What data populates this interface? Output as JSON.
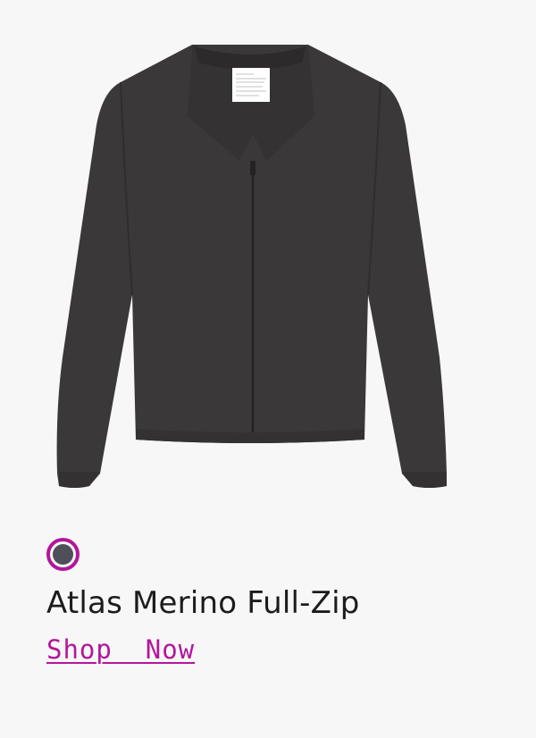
{
  "product": {
    "name": "Atlas Merino Full-Zip",
    "image_icon": "merino-full-zip-jacket-image",
    "swatch": {
      "selected_color": "#4f4f5a",
      "ring_color": "#b3169b"
    }
  },
  "cta": {
    "label": "Shop  Now",
    "color": "#b3169b"
  }
}
